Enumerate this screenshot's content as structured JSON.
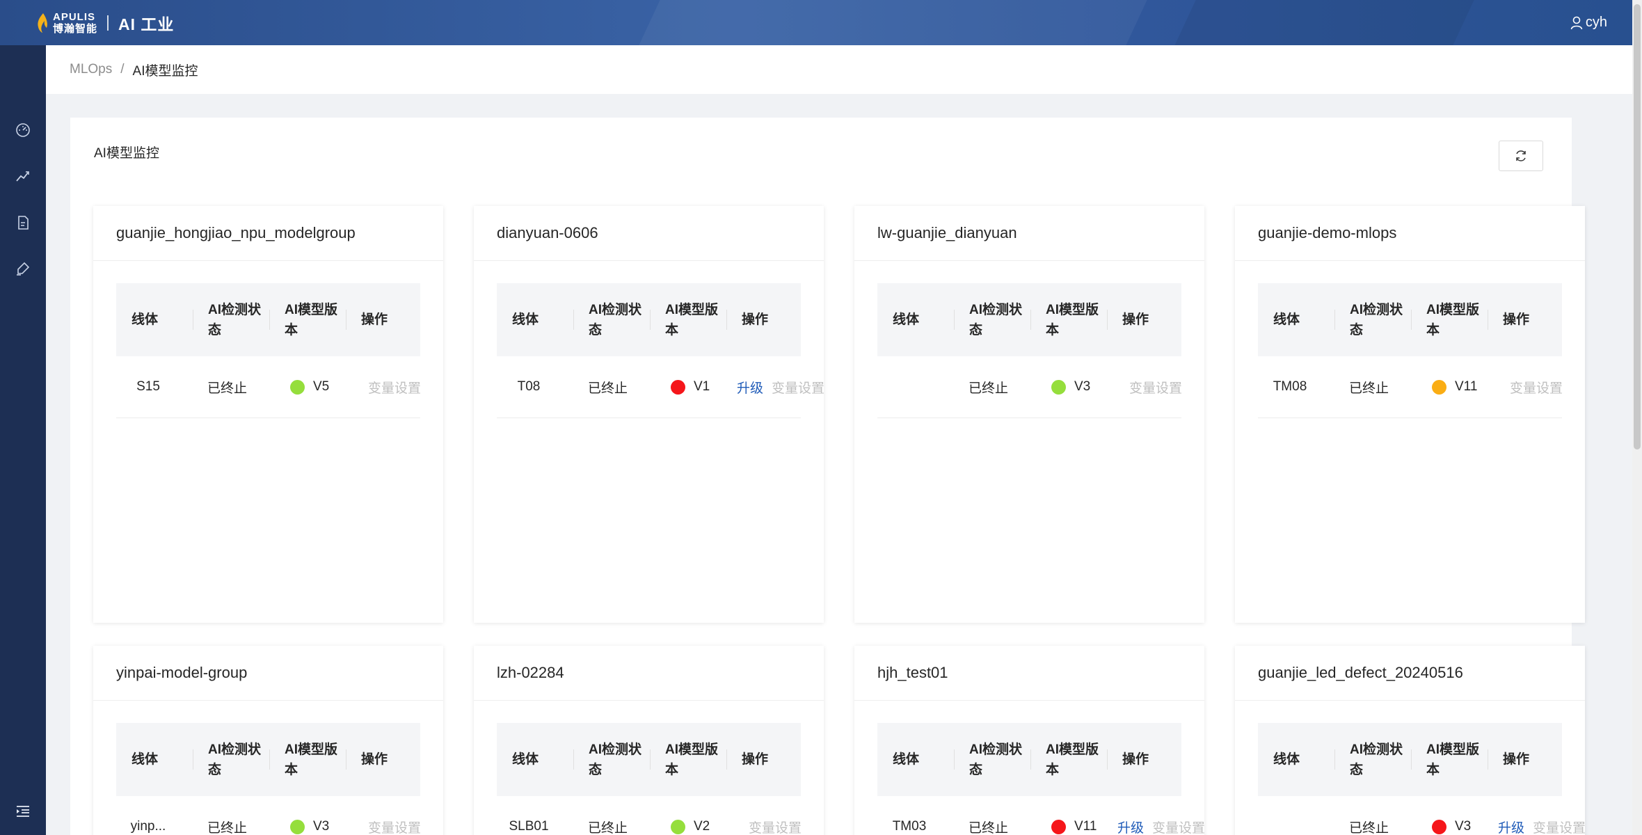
{
  "header": {
    "logo_en": "APULIS",
    "logo_cn": "博瀚智能",
    "app_title": "AI 工业",
    "user_name": "cyh"
  },
  "breadcrumb": {
    "root": "MLOps",
    "separator": "/",
    "current": "AI模型监控"
  },
  "sidebar": {
    "icons": [
      "dashboard-icon",
      "trend-icon",
      "document-icon",
      "brush-icon"
    ],
    "collapse_icon": "menu-fold-icon"
  },
  "panel": {
    "title": "AI模型监控",
    "refresh_icon": "refresh-icon"
  },
  "table_headers": {
    "line": "线体",
    "status": "AI检测状态",
    "version": "AI模型版本",
    "action": "操作"
  },
  "colors": {
    "green": "#95de3c",
    "red": "#f5161a",
    "orange": "#faad14",
    "link": "#1f5bb8",
    "disabled": "#bfbfbf"
  },
  "cards": [
    {
      "name": "guanjie_hongjiao_npu_modelgroup",
      "rows": [
        {
          "line": "S15",
          "status": "已终止",
          "dot": "green",
          "version": "V5",
          "upgrade": "",
          "setting": "变量设置"
        }
      ]
    },
    {
      "name": "dianyuan-0606",
      "rows": [
        {
          "line": "T08",
          "status": "已终止",
          "dot": "red",
          "version": "V1",
          "upgrade": "升级",
          "setting": "变量设置"
        }
      ]
    },
    {
      "name": "lw-guanjie_dianyuan",
      "rows": [
        {
          "line": "",
          "status": "已终止",
          "dot": "green",
          "version": "V3",
          "upgrade": "",
          "setting": "变量设置"
        }
      ]
    },
    {
      "name": "guanjie-demo-mlops",
      "rows": [
        {
          "line": "TM08",
          "status": "已终止",
          "dot": "orange",
          "version": "V11",
          "upgrade": "",
          "setting": "变量设置"
        }
      ]
    },
    {
      "name": "yinpai-model-group",
      "rows": [
        {
          "line": "yinp...",
          "status": "已终止",
          "dot": "green",
          "version": "V3",
          "upgrade": "",
          "setting": "变量设置"
        }
      ]
    },
    {
      "name": "lzh-02284",
      "rows": [
        {
          "line": "SLB01",
          "status": "已终止",
          "dot": "green",
          "version": "V2",
          "upgrade": "",
          "setting": "变量设置"
        }
      ]
    },
    {
      "name": "hjh_test01",
      "rows": [
        {
          "line": "TM03",
          "status": "已终止",
          "dot": "red",
          "version": "V11",
          "upgrade": "升级",
          "setting": "变量设置"
        }
      ]
    },
    {
      "name": "guanjie_led_defect_20240516",
      "rows": [
        {
          "line": "",
          "status": "已终止",
          "dot": "red",
          "version": "V3",
          "upgrade": "升级",
          "setting": "变量设置"
        }
      ]
    }
  ]
}
